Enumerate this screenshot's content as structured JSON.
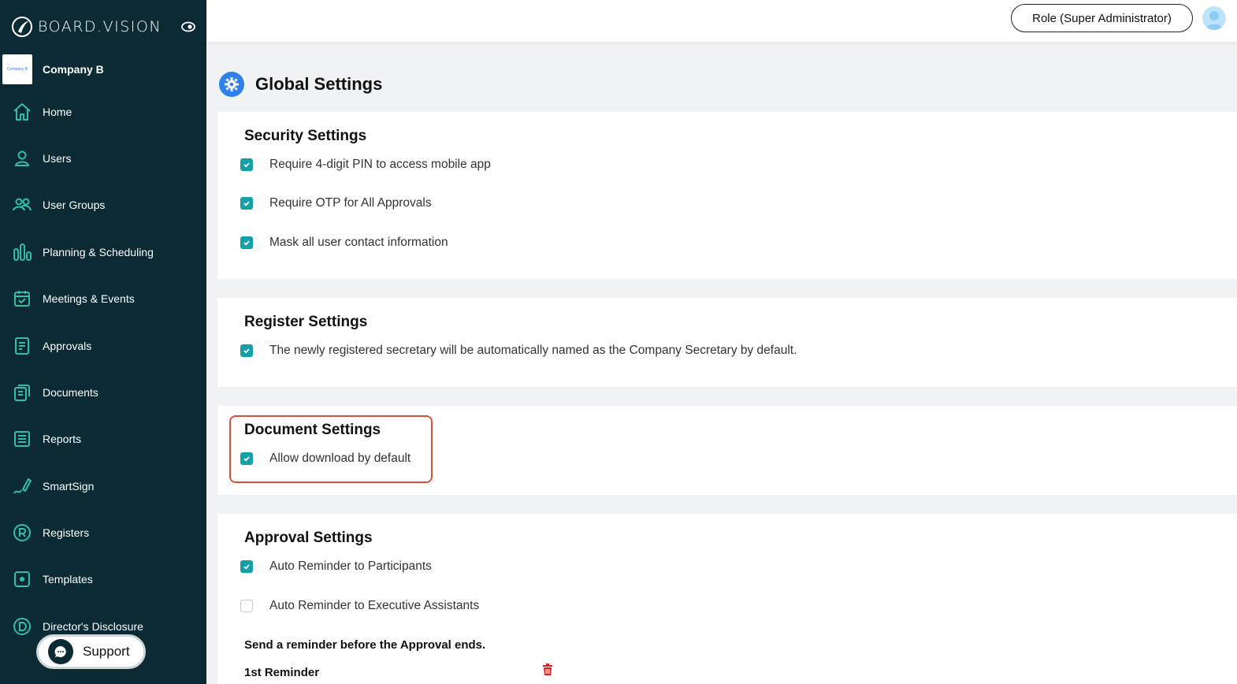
{
  "brand": {
    "name": "BOARD.VISION"
  },
  "company": {
    "name": "Company B",
    "logo_text": "Company B"
  },
  "sidebar": {
    "items": [
      {
        "label": "Home",
        "icon": "home-icon"
      },
      {
        "label": "Users",
        "icon": "user-icon"
      },
      {
        "label": "User Groups",
        "icon": "users-icon"
      },
      {
        "label": "Planning & Scheduling",
        "icon": "bars-icon"
      },
      {
        "label": "Meetings & Events",
        "icon": "calendar-icon"
      },
      {
        "label": "Approvals",
        "icon": "approval-icon"
      },
      {
        "label": "Documents",
        "icon": "documents-icon"
      },
      {
        "label": "Reports",
        "icon": "reports-icon"
      },
      {
        "label": "SmartSign",
        "icon": "pen-icon"
      },
      {
        "label": "Registers",
        "icon": "registered-icon"
      },
      {
        "label": "Templates",
        "icon": "templates-icon"
      },
      {
        "label": "Director's Disclosure",
        "icon": "disclosure-icon"
      }
    ]
  },
  "support": {
    "label": "Support"
  },
  "header": {
    "role_label": "Role (Super Administrator)"
  },
  "page": {
    "title": "Global Settings"
  },
  "security": {
    "title": "Security Settings",
    "options": [
      {
        "label": "Require 4-digit PIN to access mobile app",
        "checked": true
      },
      {
        "label": "Require OTP for All Approvals",
        "checked": true
      },
      {
        "label": "Mask all user contact information",
        "checked": true
      }
    ]
  },
  "register": {
    "title": "Register Settings",
    "options": [
      {
        "label": "The newly registered secretary will be automatically named as the Company Secretary by default.",
        "checked": true
      }
    ]
  },
  "document": {
    "title": "Document Settings",
    "options": [
      {
        "label": "Allow download by default",
        "checked": true
      }
    ]
  },
  "approval": {
    "title": "Approval Settings",
    "options": [
      {
        "label": "Auto Reminder to Participants",
        "checked": true
      },
      {
        "label": "Auto Reminder to Executive Assistants",
        "checked": false
      }
    ],
    "reminder_note": "Send a reminder before the Approval ends.",
    "first_reminder": "1st Reminder"
  },
  "colors": {
    "sidebar": "#0b2a33",
    "checkbox": "#14a0a8",
    "highlight": "#d9503a",
    "accent": "#2f80ed"
  }
}
